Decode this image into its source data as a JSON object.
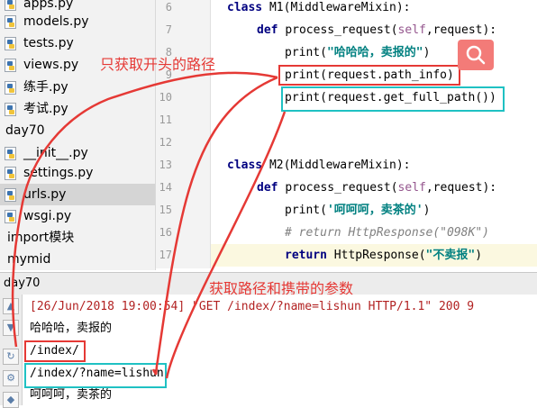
{
  "tree": {
    "items": [
      {
        "label": "apps.py",
        "icon": "python-file-icon"
      },
      {
        "label": "models.py",
        "icon": "python-file-icon"
      },
      {
        "label": "tests.py",
        "icon": "python-file-icon"
      },
      {
        "label": "views.py",
        "icon": "python-file-icon"
      },
      {
        "label": "练手.py",
        "icon": "python-file-icon"
      },
      {
        "label": "考试.py",
        "icon": "python-file-icon"
      },
      {
        "label": "day70",
        "icon": ""
      },
      {
        "label": "__init__.py",
        "icon": "python-file-icon"
      },
      {
        "label": "settings.py",
        "icon": "python-file-icon"
      },
      {
        "label": "urls.py",
        "icon": "python-file-icon"
      },
      {
        "label": "wsgi.py",
        "icon": "python-file-icon"
      },
      {
        "label": "import模块",
        "icon": ""
      },
      {
        "label": "mymid",
        "icon": ""
      }
    ]
  },
  "editor": {
    "line_numbers": [
      "6",
      "7",
      "8",
      "9",
      "10",
      "11",
      "12",
      "13",
      "14",
      "15",
      "16",
      "17"
    ],
    "class_m1": {
      "kw": "class ",
      "text": "M1(MiddlewareMixin):"
    },
    "def_m1": {
      "kw": "def ",
      "name": "process_request(",
      "self": "self",
      "rest": ",request):"
    },
    "print_haha": {
      "pre": "print(",
      "str": "\"哈哈哈，卖报的\"",
      "post": ")"
    },
    "print_path_info": "print(request.path_info)",
    "print_full_path": "print(request.get_full_path())",
    "class_m2": {
      "kw": "class ",
      "text": "M2(MiddlewareMixin):"
    },
    "def_m2": {
      "kw": "def ",
      "name": "process_request(",
      "self": "self",
      "rest": ",request):"
    },
    "print_hehe": {
      "pre": "print(",
      "str": "'呵呵呵，卖茶的'",
      "post": ")"
    },
    "comment": "# return HttpResponse(\"098K\")",
    "return_line": {
      "kw": "return ",
      "pre": "HttpResponse(",
      "str": "\"不卖报\"",
      "post": ")"
    }
  },
  "run": {
    "tab_label": "day70",
    "console": [
      "[26/Jun/2018 19:00:54] \"GET /index/?name=lishun HTTP/1.1\" 200 9",
      "哈哈哈，卖报的",
      "/index/",
      "/index/?name=lishun",
      "呵呵呵，卖茶的"
    ]
  },
  "annotations": {
    "top": "只获取开头的路径",
    "bottom": "获取路径和携带的参数"
  },
  "colors": {
    "annotation_red": "#e53935",
    "annotation_cyan": "#1fc1c3",
    "keyword": "#000080",
    "string": "#008080",
    "self": "#94558d",
    "comment": "#808080"
  }
}
